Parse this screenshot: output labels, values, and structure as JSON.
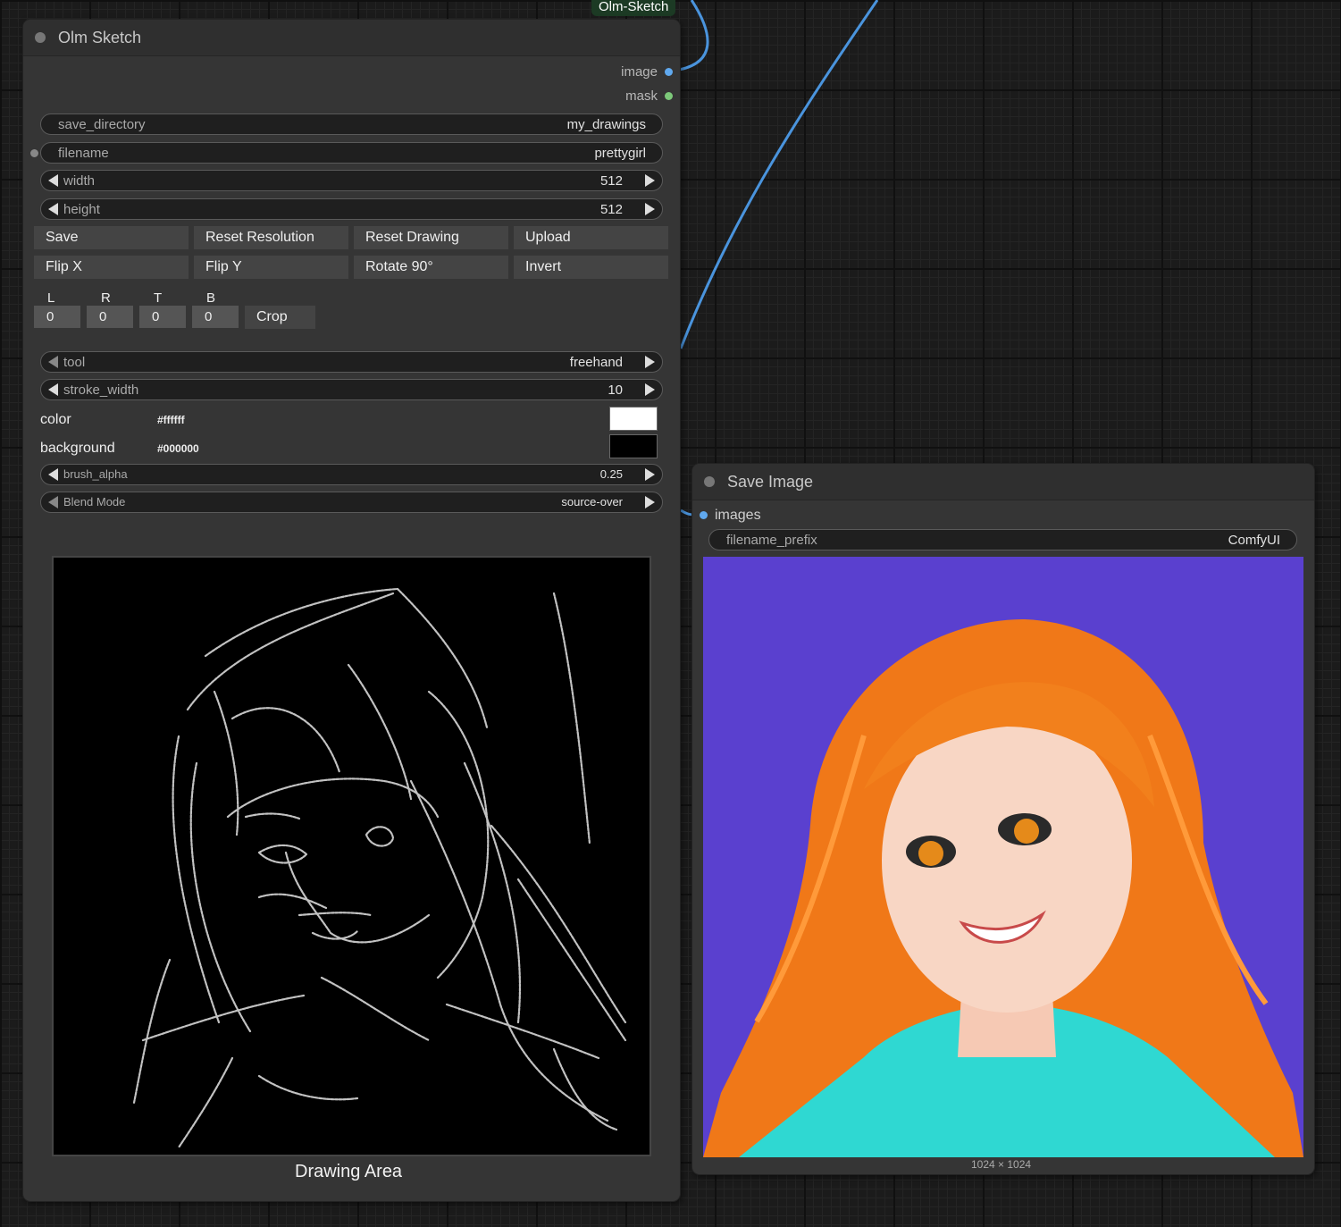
{
  "colors": {
    "image_slot": "#60a9ef",
    "mask_slot": "#7dc97a",
    "color_swatch": "#ffffff",
    "background_swatch": "#000000",
    "preview_background": "#5a40cf"
  },
  "connection_badge": "Olm-Sketch",
  "sketch_node": {
    "title": "Olm Sketch",
    "outputs": [
      "image",
      "mask"
    ],
    "save_directory": {
      "label": "save_directory",
      "value": "my_drawings"
    },
    "filename": {
      "label": "filename",
      "value": "prettygirl"
    },
    "width": {
      "label": "width",
      "value": "512"
    },
    "height": {
      "label": "height",
      "value": "512"
    },
    "buttons_row1": [
      "Save",
      "Reset Resolution",
      "Reset Drawing",
      "Upload"
    ],
    "buttons_row2": [
      "Flip X",
      "Flip Y",
      "Rotate 90°",
      "Invert"
    ],
    "crop": {
      "labels": [
        "L",
        "R",
        "T",
        "B"
      ],
      "values": [
        "0",
        "0",
        "0",
        "0"
      ],
      "button": "Crop"
    },
    "tool": {
      "label": "tool",
      "value": "freehand"
    },
    "stroke_width": {
      "label": "stroke_width",
      "value": "10"
    },
    "color": {
      "label": "color",
      "hex": "#ffffff"
    },
    "background": {
      "label": "background",
      "hex": "#000000"
    },
    "brush_alpha": {
      "label": "brush_alpha",
      "value": "0.25"
    },
    "blend_mode": {
      "label": "Blend Mode",
      "value": "source-over"
    },
    "drawing_caption": "Drawing Area"
  },
  "save_node": {
    "title": "Save Image",
    "input": "images",
    "filename_prefix": {
      "label": "filename_prefix",
      "value": "ComfyUI"
    },
    "image_dims": "1024 × 1024"
  }
}
